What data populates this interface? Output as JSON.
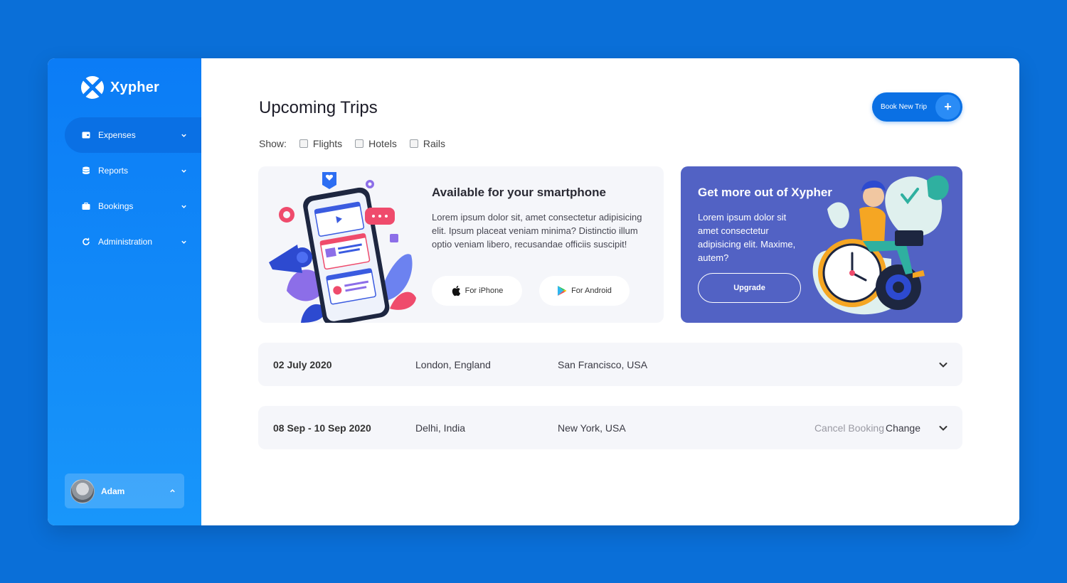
{
  "brand": {
    "name": "Xypher",
    "logo_icon": "xypher-logo-icon"
  },
  "sidebar": {
    "items": [
      {
        "label": "Expenses",
        "icon": "wallet-icon",
        "active": true
      },
      {
        "label": "Reports",
        "icon": "database-icon",
        "active": false
      },
      {
        "label": "Bookings",
        "icon": "briefcase-icon",
        "active": false
      },
      {
        "label": "Administration",
        "icon": "refresh-icon",
        "active": false
      }
    ],
    "user": {
      "name": "Adam"
    }
  },
  "header": {
    "title": "Upcoming Trips",
    "book_button": "Book New Trip",
    "book_button_icon": "+"
  },
  "filters": {
    "show_label": "Show:",
    "options": [
      {
        "label": "Flights",
        "checked": false
      },
      {
        "label": "Hotels",
        "checked": false
      },
      {
        "label": "Rails",
        "checked": false
      }
    ]
  },
  "app_card": {
    "title": "Available for your smartphone",
    "description": "Lorem ipsum dolor sit, amet consectetur adipisicing elit. Ipsum placeat veniam minima? Distinctio illum optio veniam libero, recusandae officiis suscipit!",
    "iphone_label": "For iPhone",
    "android_label": "For Android"
  },
  "pro_card": {
    "title": "Get more out of Xypher",
    "description": "Lorem ipsum dolor sit amet consectetur adipisicing elit. Maxime, autem?",
    "upgrade_label": "Upgrade"
  },
  "trips": [
    {
      "date": "02 July 2020",
      "from": "London, England",
      "to": "San Francisco, USA",
      "cancel": "",
      "change": ""
    },
    {
      "date": "08 Sep - 10 Sep 2020",
      "from": "Delhi, India",
      "to": "New York, USA",
      "cancel": "Cancel Booking",
      "change": "Change"
    }
  ],
  "colors": {
    "background": "#0a6fd8",
    "sidebar": "#0b7cf6",
    "accent": "#0a70e4",
    "pro_card": "#5262c4",
    "card_bg": "#f5f6fa"
  }
}
